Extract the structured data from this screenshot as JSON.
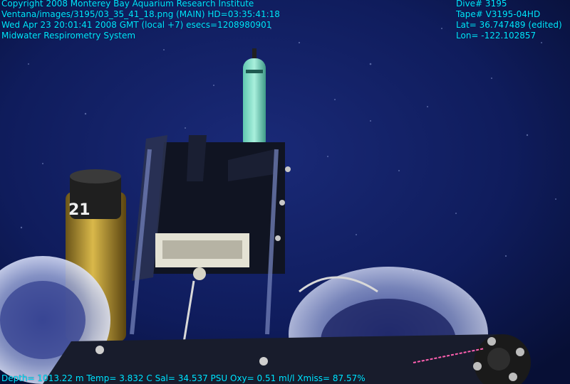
{
  "overlay": {
    "top_left": [
      "Copyright 2008 Monterey Bay Aquarium Research Institute",
      "Ventana/images/3195/03_35_41_18.png (MAIN)  HD=03:35:41:18",
      "Wed Apr 23 20:01:41 2008 GMT (local +7)  esecs=1208980901",
      "Midwater Respirometry System"
    ],
    "top_right": [
      "Dive# 3195",
      "Tape# V3195-04HD",
      "Lat= 36.747489 (edited)",
      "Lon= -122.102857"
    ],
    "bottom": "Depth= 1013.22 m  Temp= 3.832 C  Sal= 34.537 PSU  Oxy= 0.51 ml/l  Xmiss= 87.57%"
  },
  "scene": {
    "canister_label": "21"
  },
  "colors": {
    "overlay_text": "#00e5ff",
    "water": "#0d1a55"
  }
}
